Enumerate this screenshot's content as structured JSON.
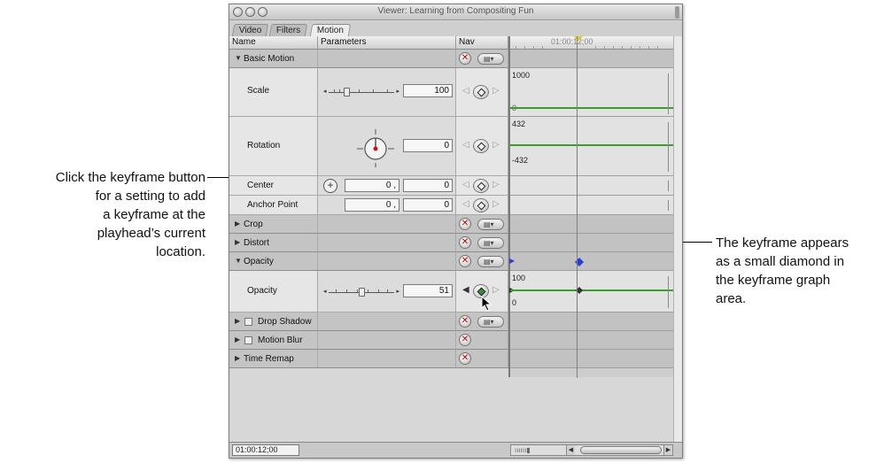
{
  "window": {
    "title": "Viewer: Learning from Compositing Fun"
  },
  "tabs": [
    "Video",
    "Filters",
    "Motion"
  ],
  "columns": {
    "name": "Name",
    "parameters": "Parameters",
    "nav": "Nav",
    "timecode": "01:00:12;00"
  },
  "rows": {
    "basic_motion": "Basic Motion",
    "scale": {
      "label": "Scale",
      "value": "100",
      "graph_max": "1000",
      "graph_min": "0"
    },
    "rotation": {
      "label": "Rotation",
      "value": "0",
      "graph_max": "432",
      "graph_min": "-432"
    },
    "center": {
      "label": "Center",
      "x": "0 ,",
      "y": "0"
    },
    "anchor": {
      "label": "Anchor Point",
      "x": "0 ,",
      "y": "0"
    },
    "crop": "Crop",
    "distort": "Distort",
    "opacity_group": "Opacity",
    "opacity": {
      "label": "Opacity",
      "value": "51",
      "graph_max": "100",
      "graph_min": "0"
    },
    "drop_shadow": "Drop Shadow",
    "motion_blur": "Motion Blur",
    "time_remap": "Time Remap"
  },
  "bottom": {
    "timecode": "01:00:12;00"
  },
  "callouts": {
    "left": [
      "Click the keyframe button",
      "for a setting to add",
      "a keyframe at the",
      "playhead’s current",
      "location."
    ],
    "right": [
      "The keyframe appears",
      "as a small diamond in",
      "the keyframe graph",
      "area."
    ]
  },
  "icons": {
    "remove": "red-x-icon",
    "menu": "popup-menu-icon",
    "keyframe": "keyframe-diamond-icon",
    "cursor": "arrow-cursor-icon"
  },
  "colors": {
    "graph_line": "#3c9c2c",
    "playhead_marker": "#d8cf2c",
    "reset_x": "#b10000",
    "keyframe_blue": "#2a3fd0"
  }
}
